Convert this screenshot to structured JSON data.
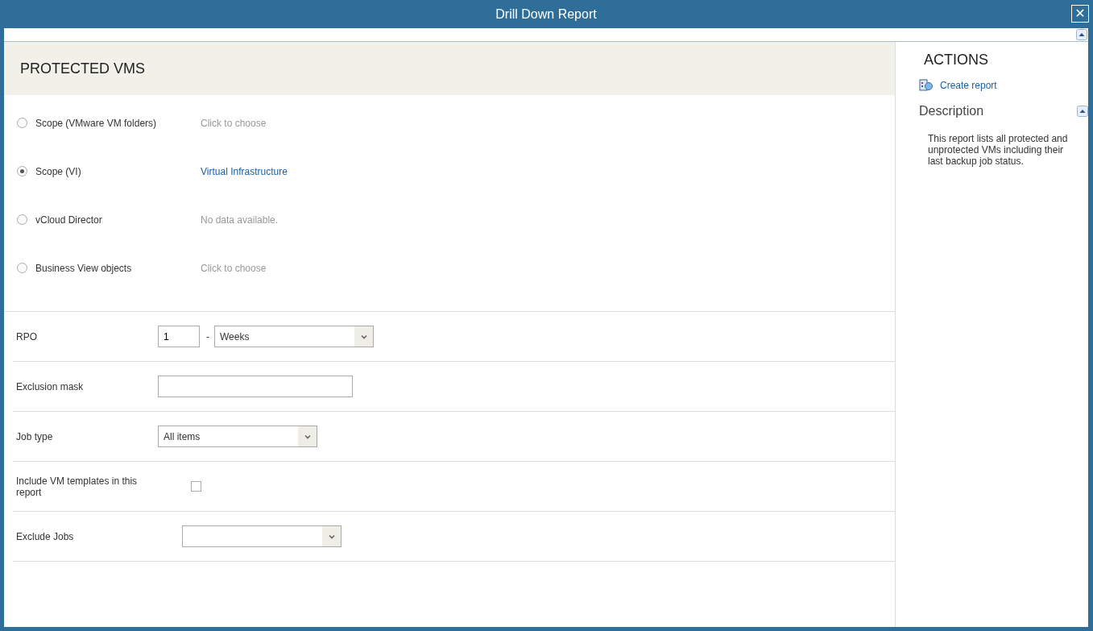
{
  "window": {
    "title": "Drill Down Report",
    "close_icon": "✕"
  },
  "heading": "PROTECTED VMS",
  "scopes": [
    {
      "label": "Scope (VMware VM folders)",
      "selected": false,
      "kind": "hint",
      "value": "Click to choose"
    },
    {
      "label": "Scope (VI)",
      "selected": true,
      "kind": "link",
      "value": "Virtual Infrastructure"
    },
    {
      "label": "vCloud Director",
      "selected": false,
      "kind": "hint",
      "value": "No data available."
    },
    {
      "label": "Business View objects",
      "selected": false,
      "kind": "hint",
      "value": "Click to choose"
    }
  ],
  "fields": [
    {
      "kind": "number_select",
      "label": "RPO",
      "number": "1",
      "separator": "-",
      "value": "Weeks"
    },
    {
      "kind": "text",
      "label": "Exclusion mask"
    },
    {
      "kind": "select",
      "label": "Job type",
      "value": "All items"
    },
    {
      "kind": "checkbox",
      "label": "Include VM templates in this report",
      "checked": false
    },
    {
      "kind": "select_wide",
      "label": "Exclude Jobs"
    }
  ],
  "actions": {
    "title": "ACTIONS",
    "items": [
      "Create report"
    ]
  },
  "description": {
    "title": "Description",
    "text": "This report lists all protected and unprotected VMs including their last backup job status."
  }
}
